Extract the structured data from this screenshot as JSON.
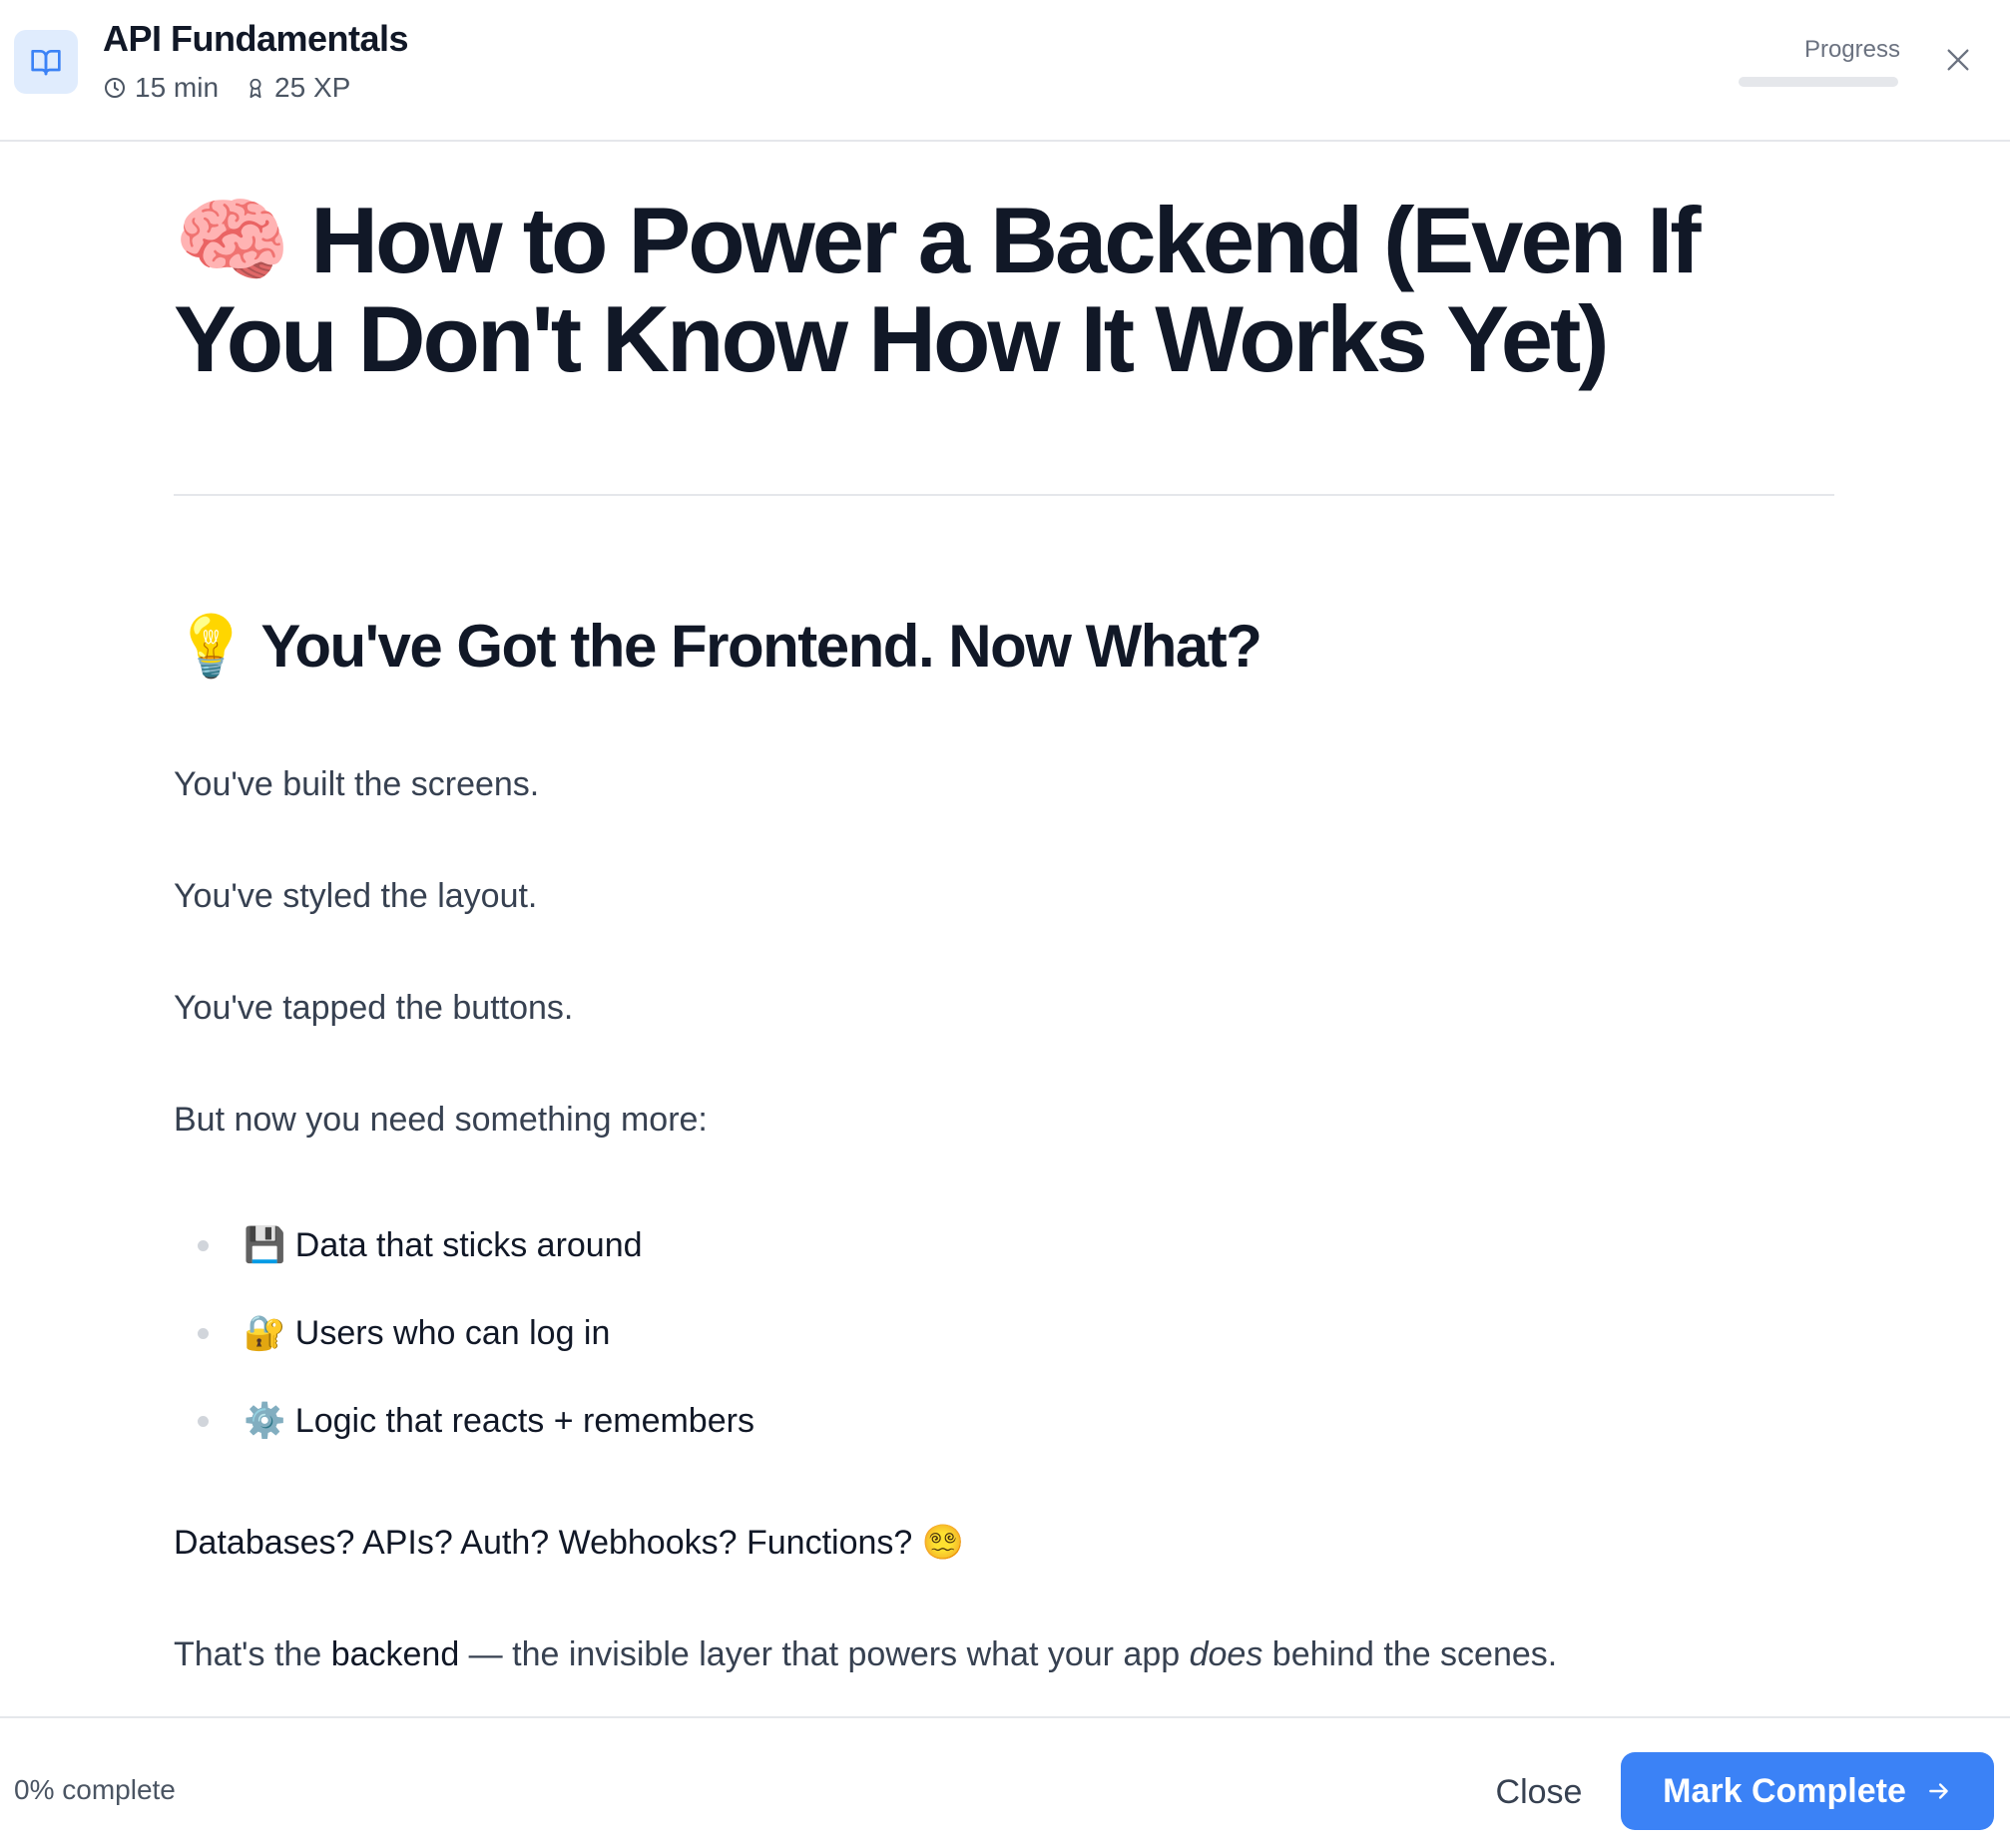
{
  "header": {
    "lesson_title": "API Fundamentals",
    "duration": "15 min",
    "xp": "25 XP",
    "progress_label": "Progress",
    "progress_value": 0
  },
  "article": {
    "title_emoji": "🧠",
    "title": "How to Power a Backend (Even If You Don't Know How It Works Yet)",
    "section_emoji": "💡",
    "section_heading": "You've Got the Frontend. Now What?",
    "paragraphs": [
      "You've built the screens.",
      "You've styled the layout.",
      "You've tapped the buttons.",
      "But now you need something more:"
    ],
    "bullets": [
      {
        "emoji": "💾",
        "text": "Data that sticks around"
      },
      {
        "emoji": "🔐",
        "text": "Users who can log in"
      },
      {
        "emoji": "⚙️",
        "text": "Logic that reacts + remembers"
      }
    ],
    "questions_text": "Databases? APIs? Auth? Webhooks? Functions?",
    "questions_emoji": "😵‍💫",
    "closing": {
      "before": "That's the ",
      "bold": "backend",
      "middle": " — the invisible layer that powers what your app ",
      "italic": "does",
      "after": " behind the scenes."
    }
  },
  "footer": {
    "complete_text": "0% complete",
    "close_label": "Close",
    "mark_complete_label": "Mark Complete"
  },
  "colors": {
    "accent": "#3b82f6",
    "icon_bg": "#e0ecfd",
    "text_dark": "#111827",
    "text_body": "#374151",
    "divider": "#e5e7eb"
  },
  "icons": [
    "book-open-icon",
    "clock-icon",
    "award-icon",
    "close-icon",
    "arrow-right-icon"
  ]
}
